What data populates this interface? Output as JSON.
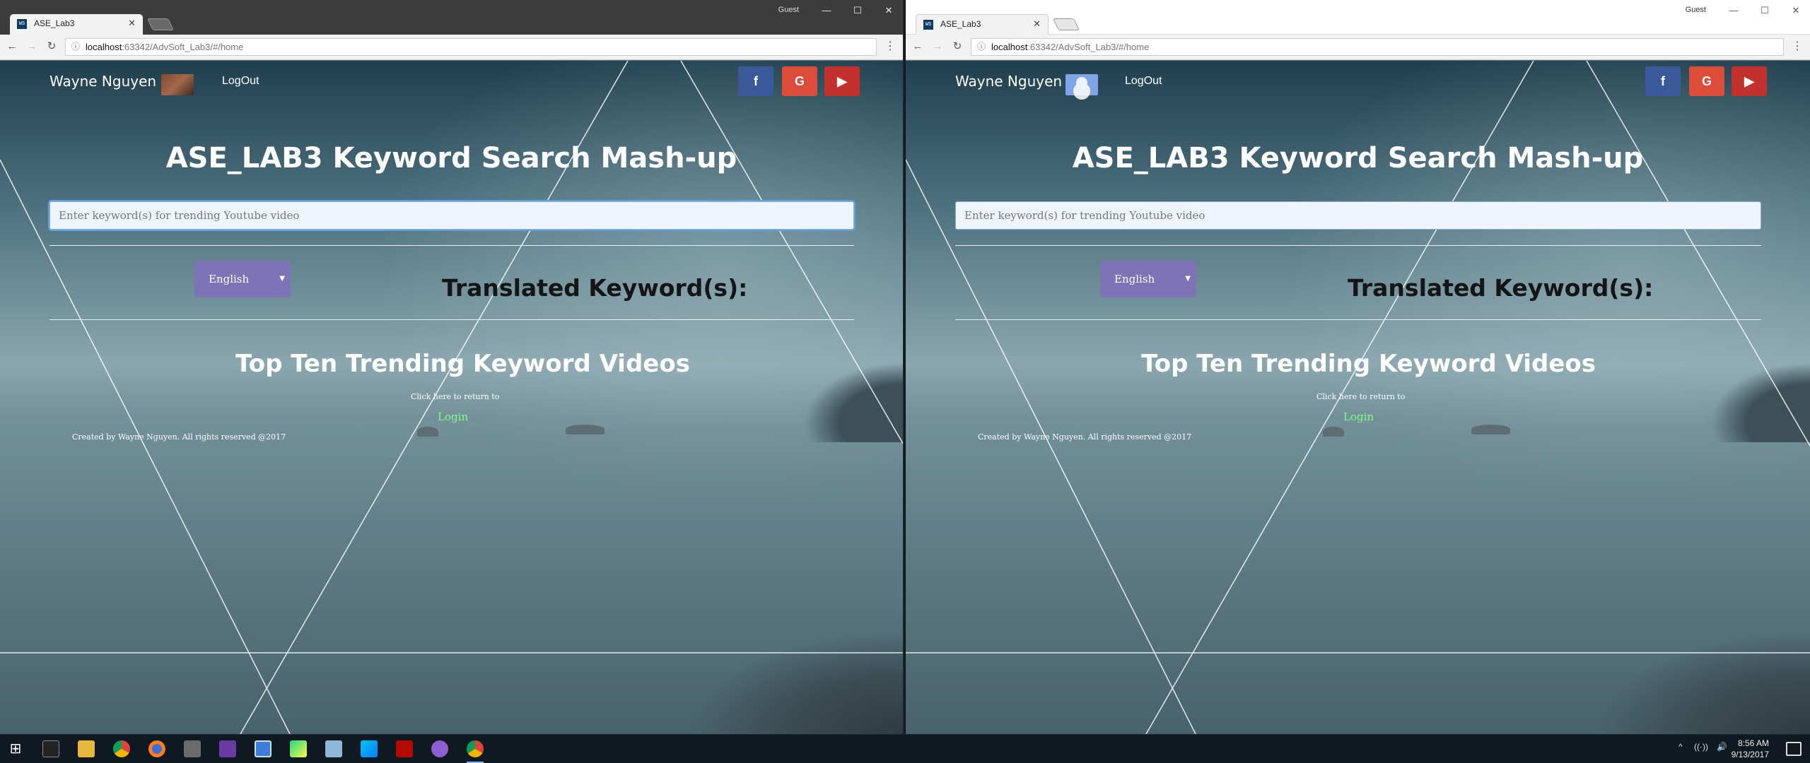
{
  "browser_left": {
    "tab_title": "ASE_Lab3",
    "favicon_text": "WS",
    "profile_label": "Guest",
    "url_host": "localhost",
    "url_path": ":63342/AdvSoft_Lab3/#/home"
  },
  "browser_right": {
    "tab_title": "ASE_Lab3",
    "favicon_text": "WS",
    "profile_label": "Guest",
    "url_host": "localhost",
    "url_path": ":63342/AdvSoft_Lab3/#/home"
  },
  "window_controls": {
    "minimize": "—",
    "maximize": "☐",
    "close": "✕"
  },
  "nav": {
    "back": "←",
    "forward": "→",
    "reload": "↻",
    "lock": "ⓘ",
    "menu": "⋮"
  },
  "page": {
    "user_name": "Wayne Nguyen",
    "logout_label": "LogOut",
    "social": {
      "facebook": "f",
      "google": "G",
      "youtube": "▶"
    },
    "title": "ASE_LAB3 Keyword Search Mash-up",
    "search_placeholder": "Enter keyword(s) for trending Youtube video",
    "language_selected": "English",
    "translated_heading": "Translated Keyword(s):",
    "trending_heading": "Top Ten Trending Keyword Videos",
    "return_text": "Click here to return to",
    "login_link": "Login",
    "footer": "Created by Wayne Nguyen. All rights reserved @2017"
  },
  "taskbar": {
    "start": "⊞",
    "apps": [
      "terminal",
      "file-explorer",
      "chrome",
      "firefox",
      "tools",
      "visual-studio",
      "remote-desktop",
      "pycharm",
      "notes",
      "webstorm",
      "acrobat",
      "app-circle",
      "chrome-active"
    ],
    "tray": {
      "chevron": "^",
      "network": "((·))",
      "volume": "🔊"
    },
    "time": "8:56 AM",
    "date": "9/13/2017"
  },
  "colors": {
    "facebook": "#3b5998",
    "google": "#dd4b39",
    "youtube": "#c4302b",
    "language_button": "#7f73b7",
    "login_link": "#7fff7f"
  }
}
